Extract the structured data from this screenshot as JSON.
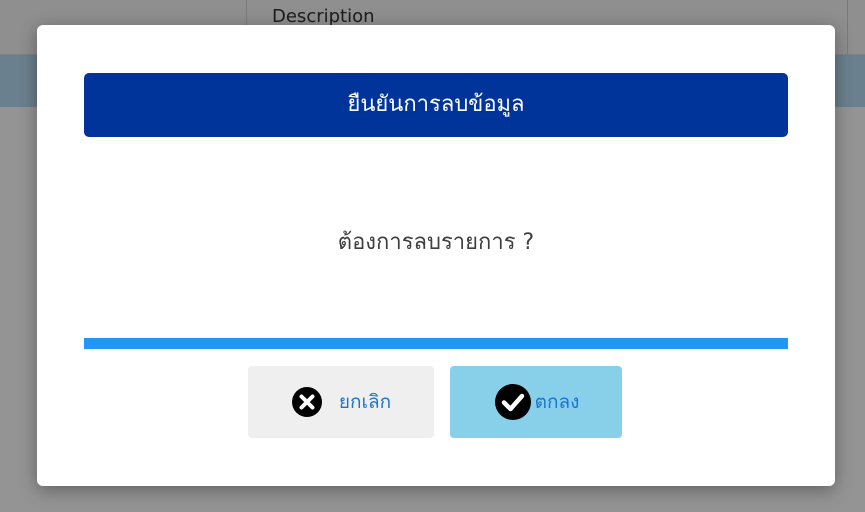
{
  "background": {
    "column_header": "Description"
  },
  "modal": {
    "title": "ยืนยันการลบข้อมูล",
    "message": "ต้องการลบรายการ ?",
    "cancel_label": "ยกเลิก",
    "ok_label": "ตกลง",
    "cancel_icon": "close-circle-icon",
    "ok_icon": "check-circle-icon"
  },
  "colors": {
    "title_bar": "#00349a",
    "divider": "#2196f3",
    "ok_button": "#88cfea",
    "cancel_button": "#efefef",
    "button_text": "#1a75cf"
  }
}
